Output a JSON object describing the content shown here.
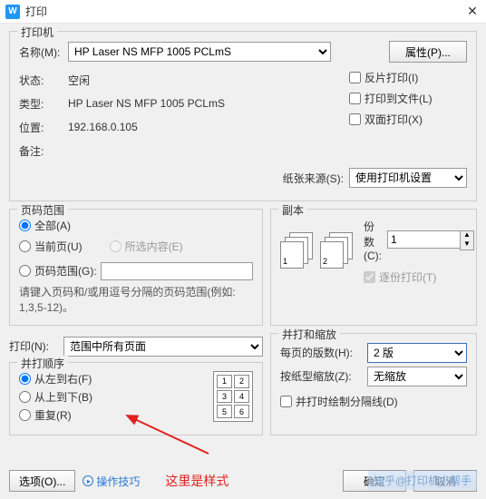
{
  "window": {
    "title": "打印",
    "close": "✕"
  },
  "printer": {
    "group_label": "打印机",
    "name_label": "名称(M):",
    "name_value": "HP Laser NS MFP 1005 PCLmS",
    "status_label": "状态:",
    "status_value": "空闲",
    "type_label": "类型:",
    "type_value": "HP Laser NS MFP 1005 PCLmS",
    "where_label": "位置:",
    "where_value": "192.168.0.105",
    "comment_label": "备注:",
    "properties_btn": "属性(P)...",
    "mirror_chk": "反片打印(I)",
    "tofile_chk": "打印到文件(L)",
    "duplex_chk": "双面打印(X)",
    "paper_src_label": "纸张来源(S):",
    "paper_src_value": "使用打印机设置"
  },
  "range": {
    "group_label": "页码范围",
    "all": "全部(A)",
    "current": "当前页(U)",
    "selection": "所选内容(E)",
    "pages": "页码范围(G):",
    "hint": "请键入页码和/或用逗号分隔的页码范围(例如: 1,3,5-12)。"
  },
  "copies": {
    "group_label": "副本",
    "count_label": "份数(C):",
    "count_value": "1",
    "collate": "逐份打印(T)"
  },
  "printwhat": {
    "label": "打印(N):",
    "value": "范围中所有页面"
  },
  "order": {
    "group_label": "并打顺序",
    "ltr": "从左到右(F)",
    "ttb": "从上到下(B)",
    "repeat": "重复(R)",
    "preview_cells": [
      "1",
      "2",
      "3",
      "4",
      "5",
      "6"
    ]
  },
  "zoom": {
    "group_label": "并打和缩放",
    "pps_label": "每页的版数(H):",
    "pps_value": "2 版",
    "scale_label": "按纸型缩放(Z):",
    "scale_value": "无缩放",
    "sep_line": "并打时绘制分隔线(D)"
  },
  "footer": {
    "options_btn": "选项(O)...",
    "tips": "操作技巧",
    "ok": "确定",
    "cancel": "取消",
    "annotation": "这里是样式"
  },
  "watermark": "知乎@打印机小帮手"
}
